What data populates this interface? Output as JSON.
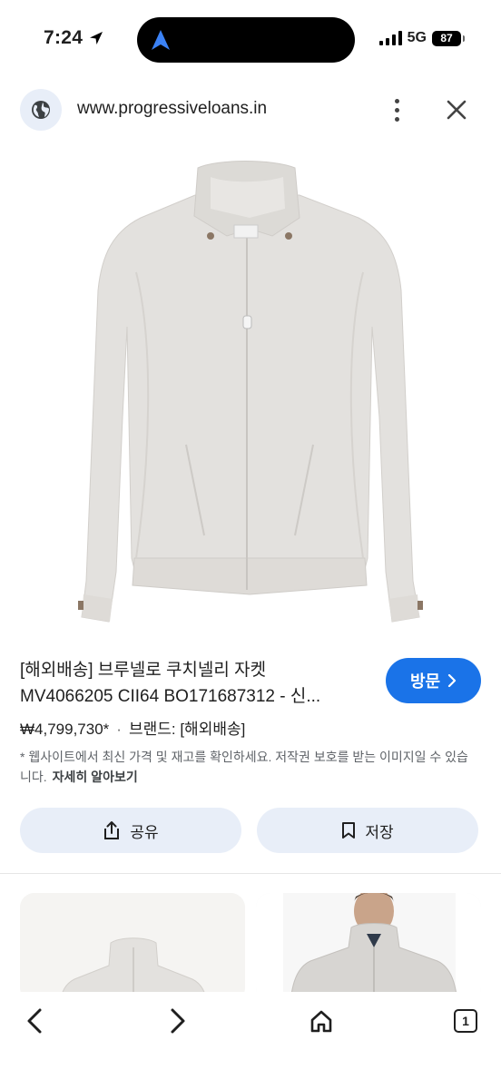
{
  "status_bar": {
    "time": "7:24",
    "network": "5G",
    "battery": "87"
  },
  "browser": {
    "url": "www.progressiveloans.in"
  },
  "product": {
    "title_line1": "[해외배송] 브루넬로 쿠치넬리 자켓",
    "title_line2": "MV4066205 CII64 BO171687312 - 신...",
    "visit_label": "방문",
    "price": "₩4,799,730*",
    "dot": "·",
    "brand": "브랜드: [해외배송]",
    "notice": "* 웹사이트에서 최신 가격 및 재고를 확인하세요. 저작권 보호를 받는 이미지일 수 있습니다.",
    "learn_more": "자세히 알아보기"
  },
  "actions": {
    "share_label": "공유",
    "save_label": "저장"
  },
  "bottom_nav": {
    "tab_count": "1"
  },
  "colors": {
    "accent": "#1a73e8",
    "chip_bg": "#e8eef8",
    "jacket": "#e3e1de"
  }
}
